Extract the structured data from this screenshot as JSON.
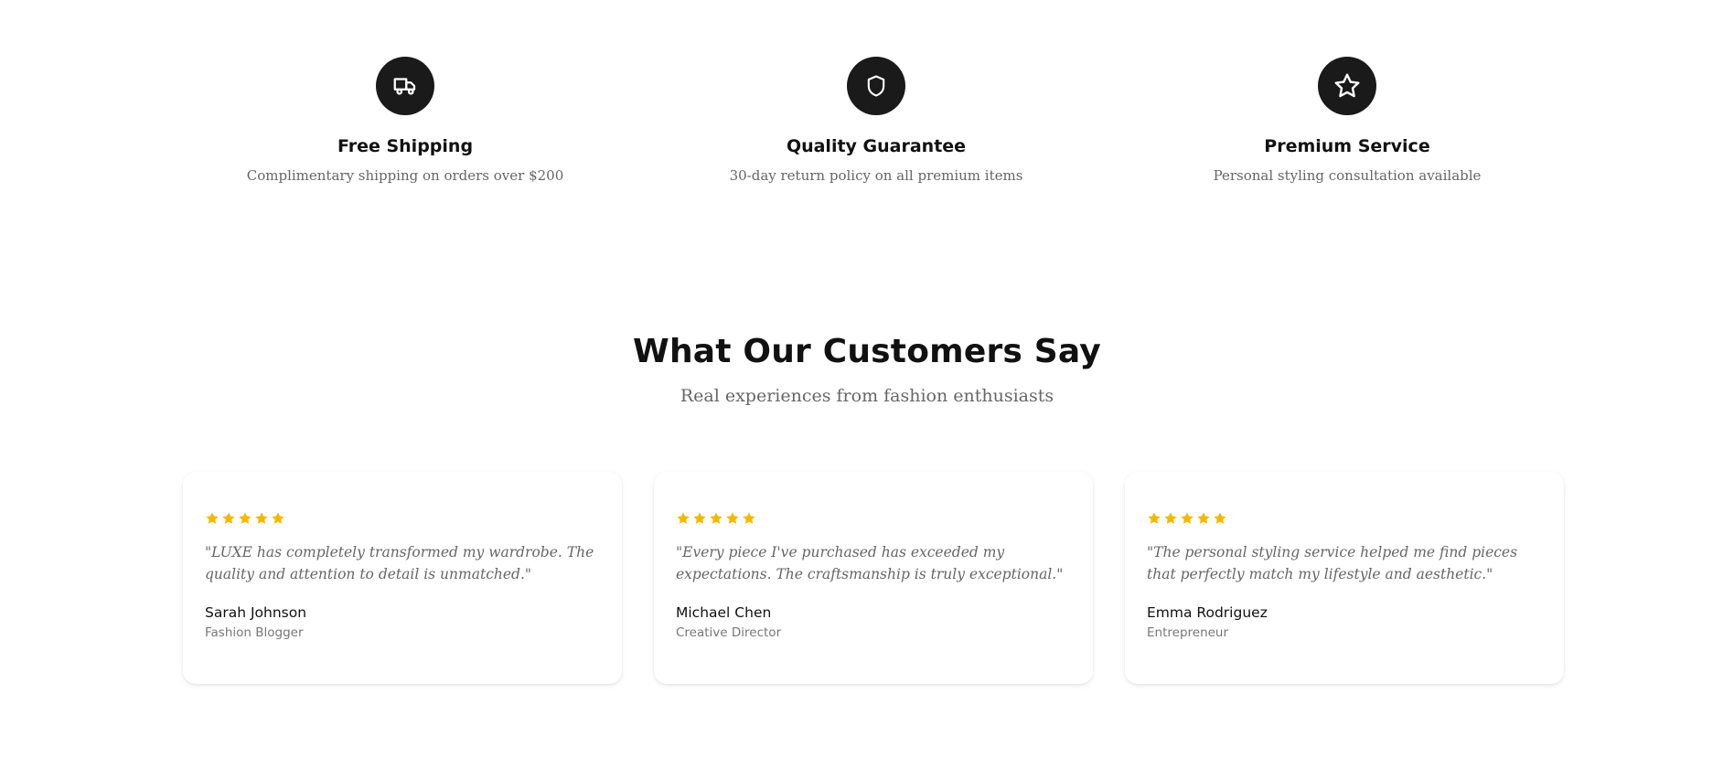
{
  "features": [
    {
      "icon": "truck-icon",
      "title": "Free Shipping",
      "description": "Complimentary shipping on orders over $200"
    },
    {
      "icon": "shield-icon",
      "title": "Quality Guarantee",
      "description": "30-day return policy on all premium items"
    },
    {
      "icon": "star-icon",
      "title": "Premium Service",
      "description": "Personal styling consultation available"
    }
  ],
  "testimonials_section": {
    "title": "What Our Customers Say",
    "subtitle": "Real experiences from fashion enthusiasts"
  },
  "testimonials": [
    {
      "rating": 5,
      "quote": "\"LUXE has completely transformed my wardrobe. The quality and attention to detail is unmatched.\"",
      "name": "Sarah Johnson",
      "role": "Fashion Blogger"
    },
    {
      "rating": 5,
      "quote": "\"Every piece I've purchased has exceeded my expectations. The craftsmanship is truly exceptional.\"",
      "name": "Michael Chen",
      "role": "Creative Director"
    },
    {
      "rating": 5,
      "quote": "\"The personal styling service helped me find pieces that perfectly match my lifestyle and aesthetic.\"",
      "name": "Emma Rodriguez",
      "role": "Entrepreneur"
    }
  ],
  "colors": {
    "icon_background": "#1a1a1a",
    "star": "#f5b800",
    "muted_text": "#666666"
  }
}
